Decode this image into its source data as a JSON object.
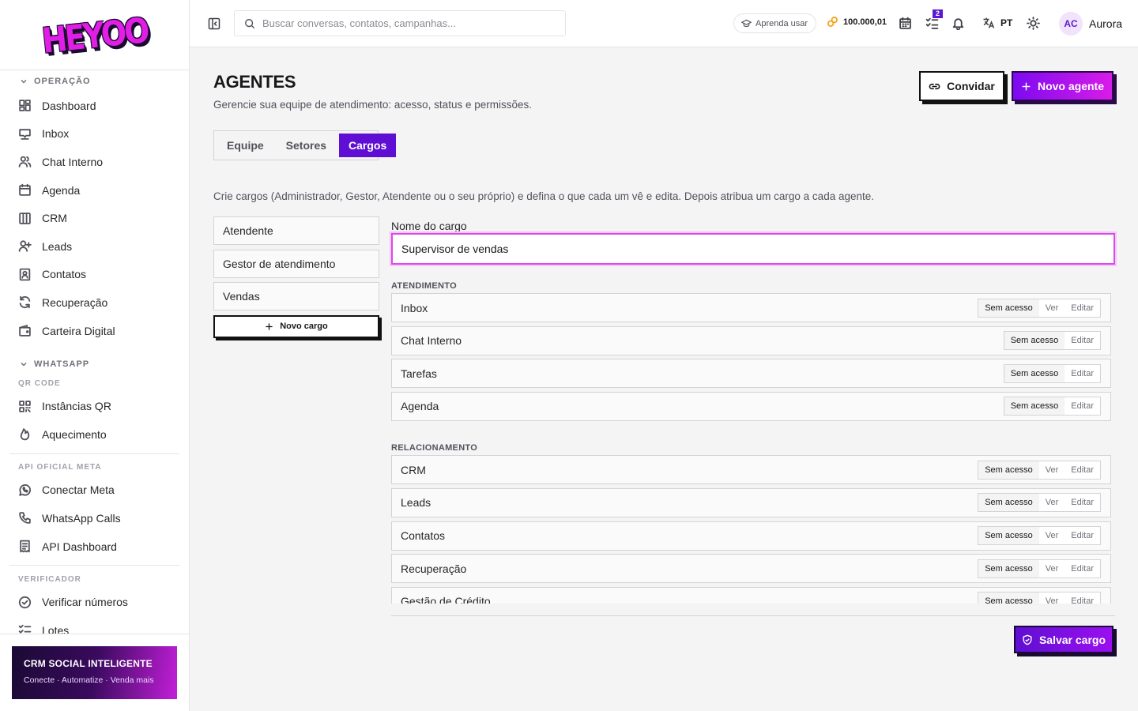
{
  "brand": {
    "logo_text": "HEYOO"
  },
  "sidebar": {
    "sections": [
      {
        "title": "OPERAÇÃO",
        "items": [
          {
            "label": "Dashboard",
            "icon": "dashboard-icon"
          },
          {
            "label": "Inbox",
            "icon": "inbox-icon"
          },
          {
            "label": "Chat Interno",
            "icon": "users-icon"
          },
          {
            "label": "Agenda",
            "icon": "calendar-icon"
          },
          {
            "label": "CRM",
            "icon": "kanban-icon"
          },
          {
            "label": "Leads",
            "icon": "user-plus-icon"
          },
          {
            "label": "Contatos",
            "icon": "contact-book-icon"
          },
          {
            "label": "Recuperação",
            "icon": "refresh-icon"
          },
          {
            "label": "Carteira Digital",
            "icon": "wallet-icon"
          }
        ]
      },
      {
        "title": "WHATSAPP",
        "subtitle": "QR CODE",
        "items": [
          {
            "label": "Instâncias QR",
            "icon": "qr-code-icon"
          },
          {
            "label": "Aquecimento",
            "icon": "flame-icon"
          }
        ]
      },
      {
        "subtitle": "API OFICIAL META",
        "items": [
          {
            "label": "Conectar Meta",
            "icon": "whatsapp-icon"
          },
          {
            "label": "WhatsApp Calls",
            "icon": "phone-icon"
          },
          {
            "label": "API Dashboard",
            "icon": "receipt-icon"
          }
        ]
      },
      {
        "subtitle": "VERIFICADOR",
        "items": [
          {
            "label": "Verificar números",
            "icon": "check-circle-icon"
          },
          {
            "label": "Lotes",
            "icon": "list-check-icon"
          }
        ]
      }
    ],
    "promo": {
      "title": "CRM SOCIAL INTELIGENTE",
      "subtitle": "Conecte · Automatize · Venda mais"
    }
  },
  "topbar": {
    "search_placeholder": "Buscar conversas, contatos, campanhas...",
    "learn_label": "Aprenda usar",
    "credits": "100.000,01",
    "tasks_badge": "2",
    "language": "PT",
    "user": {
      "initials": "AC",
      "name": "Aurora"
    }
  },
  "page": {
    "title": "AGENTES",
    "subtitle": "Gerencie sua equipe de atendimento: acesso, status e permissões.",
    "invite_label": "Convidar",
    "new_agent_label": "Novo agente",
    "tabs": [
      {
        "label": "Equipe",
        "active": false
      },
      {
        "label": "Setores",
        "active": false
      },
      {
        "label": "Cargos",
        "active": true
      }
    ],
    "intro": "Crie cargos (Administrador, Gestor, Atendente ou o seu próprio) e defina o que cada um vê e edita. Depois atribua um cargo a cada agente."
  },
  "roles": {
    "items": [
      "Atendente",
      "Gestor de atendimento",
      "Vendas"
    ],
    "new_label": "Novo cargo"
  },
  "editor": {
    "name_label": "Nome do cargo",
    "name_value": "Supervisor de vendas",
    "groups": [
      {
        "title": "ATENDIMENTO",
        "rows": [
          {
            "name": "Inbox",
            "options": [
              "Sem acesso",
              "Ver",
              "Editar"
            ],
            "selected": "Sem acesso"
          },
          {
            "name": "Chat Interno",
            "options": [
              "Sem acesso",
              "Editar"
            ],
            "selected": "Sem acesso"
          },
          {
            "name": "Tarefas",
            "options": [
              "Sem acesso",
              "Editar"
            ],
            "selected": "Sem acesso"
          },
          {
            "name": "Agenda",
            "options": [
              "Sem acesso",
              "Editar"
            ],
            "selected": "Sem acesso"
          }
        ]
      },
      {
        "title": "RELACIONAMENTO",
        "rows": [
          {
            "name": "CRM",
            "options": [
              "Sem acesso",
              "Ver",
              "Editar"
            ],
            "selected": "Sem acesso"
          },
          {
            "name": "Leads",
            "options": [
              "Sem acesso",
              "Ver",
              "Editar"
            ],
            "selected": "Sem acesso"
          },
          {
            "name": "Contatos",
            "options": [
              "Sem acesso",
              "Ver",
              "Editar"
            ],
            "selected": "Sem acesso"
          },
          {
            "name": "Recuperação",
            "options": [
              "Sem acesso",
              "Ver",
              "Editar"
            ],
            "selected": "Sem acesso"
          },
          {
            "name": "Gestão de Crédito",
            "options": [
              "Sem acesso",
              "Ver",
              "Editar"
            ],
            "selected": "Sem acesso"
          }
        ]
      }
    ],
    "save_label": "Salvar cargo"
  },
  "colors": {
    "accent": "#5f0fd3",
    "brand_pink": "#e11ee6"
  }
}
